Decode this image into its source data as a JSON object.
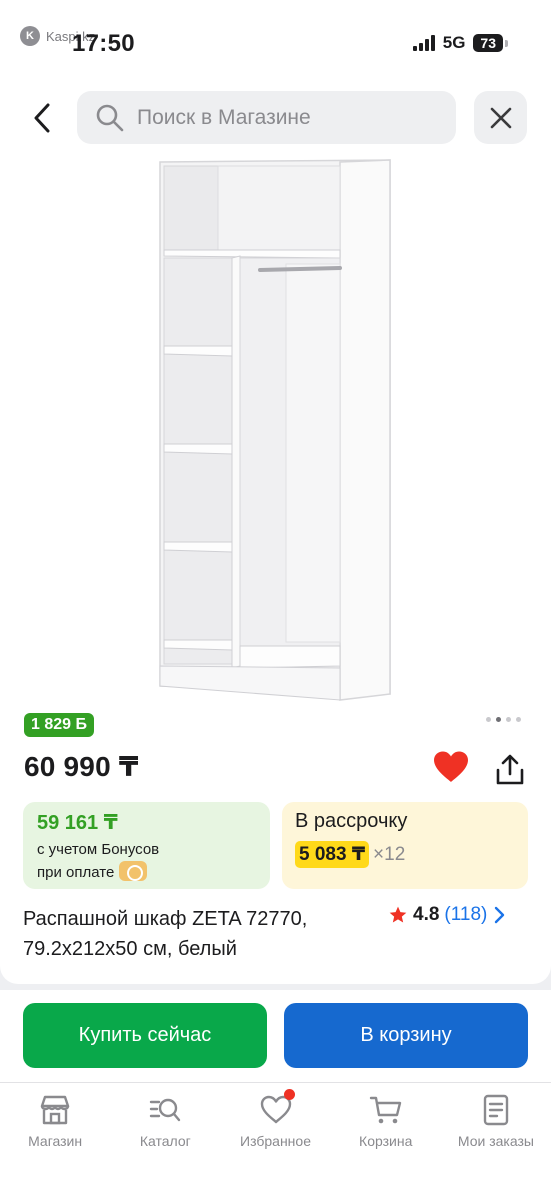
{
  "status_bar": {
    "source_app": "Kaspi.kz",
    "time": "17:50",
    "network": "5G",
    "battery": "73"
  },
  "header": {
    "search_placeholder": "Поиск в Магазине"
  },
  "product": {
    "bonus_badge": "1 829 Б",
    "price": "60 990 ₸",
    "bonus_price": "59 161 ₸",
    "bonus_note_1": "с учетом Бонусов",
    "bonus_note_2": "при оплате",
    "installment_label": "В рассрочку",
    "installment_amount": "5 083 ₸",
    "installment_months": "×12",
    "title": "Распашной шкаф ZETA 72770, 79.2x212x50 см, белый",
    "rating": "4.8",
    "reviews": "(118)",
    "image_dots_total": 4,
    "image_dot_active": 2
  },
  "actions": {
    "buy_now": "Купить сейчас",
    "add_to_cart": "В корзину"
  },
  "tabs": [
    {
      "label": "Магазин",
      "icon": "store-icon"
    },
    {
      "label": "Каталог",
      "icon": "catalog-icon"
    },
    {
      "label": "Избранное",
      "icon": "heart-icon"
    },
    {
      "label": "Корзина",
      "icon": "cart-icon"
    },
    {
      "label": "Мои заказы",
      "icon": "orders-icon"
    }
  ],
  "colors": {
    "bonus_green": "#33a024",
    "buy_green": "#09a84a",
    "cart_blue": "#1669cf",
    "installment_yellow": "#ffd91a",
    "favorite_red": "#ef3124",
    "link_blue": "#1a73e8"
  }
}
